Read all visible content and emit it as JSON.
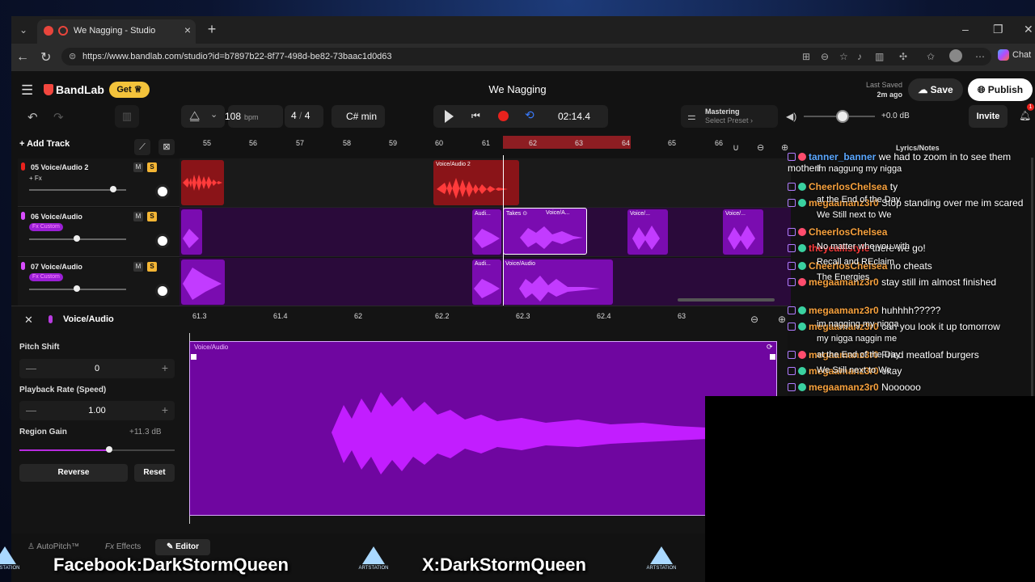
{
  "browser": {
    "tab_title": "We Nagging - Studio",
    "url": "https://www.bandlab.com/studio?id=b7897b22-8f77-498d-be82-73baac1d0d63",
    "chat_label": "Chat"
  },
  "header": {
    "logo": "BandLab",
    "get_label": "Get",
    "project_title": "We Nagging",
    "last_saved_label": "Last Saved",
    "last_saved_time": "2m ago",
    "save_label": "Save",
    "publish_label": "Publish"
  },
  "toolbar": {
    "tempo": "108",
    "tempo_unit": "bpm",
    "meter_num": "4",
    "meter_sep": "/",
    "meter_den": "4",
    "key": "C# min",
    "time": "02:14.4",
    "mastering_title": "Mastering",
    "mastering_preset": "Select Preset ›",
    "volume_db": "+0.0 dB",
    "invite_label": "Invite",
    "notification_count": "1"
  },
  "tracks_panel": {
    "add_track_label": "Add Track",
    "bars": [
      "55",
      "56",
      "57",
      "58",
      "59",
      "60",
      "61",
      "62",
      "63",
      "64",
      "65",
      "66"
    ],
    "tracks": [
      {
        "name": "05  Voice/Audio 2",
        "fx": "+ Fx",
        "m": "M",
        "s": "S"
      },
      {
        "name": "06  Voice/Audio",
        "fx": "Fx Custom",
        "m": "M",
        "s": "S"
      },
      {
        "name": "07  Voice/Audio",
        "fx": "Fx Custom",
        "m": "M",
        "s": "S"
      }
    ],
    "clip_labels": {
      "t5_b": "Voice/Audio 2",
      "t6_a": "Audi...",
      "t6_takes": "Takes ⊙",
      "t6_b": "Voice/A...",
      "t6_c": "Voice/...",
      "t6_d": "Voice/...",
      "t7_a": "Audi...",
      "t7_b": "Voice/Audio"
    }
  },
  "editor": {
    "title": "Voice/Audio",
    "ticks": [
      "61.3",
      "61.4",
      "62",
      "62.2",
      "62.3",
      "62.4",
      "63"
    ],
    "pitch_label": "Pitch Shift",
    "pitch_value": "0",
    "rate_label": "Playback Rate (Speed)",
    "rate_value": "1.00",
    "gain_label": "Region Gain",
    "gain_value": "+11.3 dB",
    "gain_level_fraction": 0.58,
    "reverse_label": "Reverse",
    "reset_label": "Reset",
    "clip_label": "Voice/Audio"
  },
  "bottom_tabs": {
    "autopitch": "AutoPitch™",
    "effects": "Effects",
    "editor": "Editor"
  },
  "chat": {
    "panel_title": "Lyrics/Notes",
    "messages": [
      {
        "user": "tanner_banner",
        "color": "#5aa7ff",
        "text": "we had to zoom in to see them motherf"
      },
      {
        "user": "CheerlosChelsea",
        "color": "#f7a13d",
        "text": "ty"
      },
      {
        "user": "megaamanz3r0",
        "color": "#f7a13d",
        "text": "Stop standing over me im scared"
      },
      {
        "user": "CheerlosChelsea",
        "color": "#f7a13d",
        "text": ""
      },
      {
        "user": "theyealllstyle",
        "color": "#ff3b3b",
        "text": "there we go!"
      },
      {
        "user": "CheerlosChelsea",
        "color": "#f7a13d",
        "text": "no cheats"
      },
      {
        "user": "megaamanz3r0",
        "color": "#f7a13d",
        "text": "stay still im almost finished"
      },
      {
        "user": "megaamanz3r0",
        "color": "#f7a13d",
        "text": "huhhhh?????"
      },
      {
        "user": "megaamanz3r0",
        "color": "#f7a13d",
        "text": "can you look it up tomorrow"
      },
      {
        "user": "megaamanz3r0",
        "color": "#f7a13d",
        "text": "Fried meatloaf burgers"
      },
      {
        "user": "megaamanz3r0",
        "color": "#f7a13d",
        "text": "okay"
      },
      {
        "user": "megaamanz3r0",
        "color": "#f7a13d",
        "text": "Noooooo"
      }
    ],
    "lyrics": [
      "im naggung my nigga",
      "at the End of the Day",
      "We Still next to We",
      "No matter whe you with",
      "Recall and REclaim",
      "The Energies",
      "im nagging my nigga",
      "my nigga naggin me",
      "at the End of the Day",
      "We Still next to We"
    ]
  },
  "footer": {
    "facebook": "Facebook:DarkStormQueen",
    "x": "X:DarkStormQueen",
    "artstation": "ARTSTATION"
  }
}
